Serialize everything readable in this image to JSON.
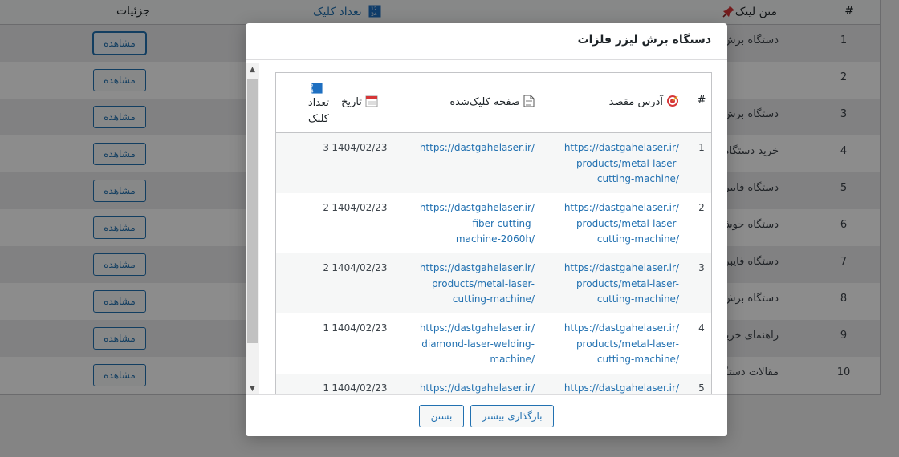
{
  "background": {
    "headers": {
      "index": "#",
      "link_text": "متن لینک",
      "click_count": "تعداد کلیک",
      "details": "جزئیات"
    },
    "view_label": "مشاهده",
    "rows": [
      {
        "n": "1",
        "text": "دستگاه برش لیز"
      },
      {
        "n": "2",
        "text": ""
      },
      {
        "n": "3",
        "text": "دستگاه برش لیز"
      },
      {
        "n": "4",
        "text": "خرید دستگاه بر"
      },
      {
        "n": "5",
        "text": "دستگاه فایبربرش"
      },
      {
        "n": "6",
        "text": "دستگاه جوش لیز"
      },
      {
        "n": "7",
        "text": "دستگاه فایبر مار"
      },
      {
        "n": "8",
        "text": "دستگاه برش فای"
      },
      {
        "n": "9",
        "text": "راهنمای خرید دس"
      },
      {
        "n": "10",
        "text": "مقالات دستگاه ب"
      }
    ]
  },
  "modal": {
    "title": "دستگاه برش لیزر فلزات",
    "columns": {
      "index": "#",
      "target": "آدرس مقصد",
      "page": "صفحه کلیک‌شده",
      "date": "تاریخ",
      "clicks": "تعداد کلیک"
    },
    "rows": [
      {
        "n": "1",
        "target": [
          "https://dastgahelaser.ir/",
          "products/metal-laser-",
          "cutting-machine/"
        ],
        "page": [
          "https://dastgahelaser.ir/"
        ],
        "date": "1404/02/23",
        "clicks": "3"
      },
      {
        "n": "2",
        "target": [
          "https://dastgahelaser.ir/",
          "products/metal-laser-",
          "cutting-machine/"
        ],
        "page": [
          "https://dastgahelaser.ir/",
          "fiber-cutting-",
          "machine-2060h/"
        ],
        "date": "1404/02/23",
        "clicks": "2"
      },
      {
        "n": "3",
        "target": [
          "https://dastgahelaser.ir/",
          "products/metal-laser-",
          "cutting-machine/"
        ],
        "page": [
          "https://dastgahelaser.ir/",
          "products/metal-laser-",
          "cutting-machine/"
        ],
        "date": "1404/02/23",
        "clicks": "2"
      },
      {
        "n": "4",
        "target": [
          "https://dastgahelaser.ir/",
          "products/metal-laser-",
          "cutting-machine/"
        ],
        "page": [
          "https://dastgahelaser.ir/",
          "diamond-laser-welding-",
          "machine/"
        ],
        "date": "1404/02/23",
        "clicks": "1"
      },
      {
        "n": "5",
        "target": [
          "https://dastgahelaser.ir/"
        ],
        "page": [
          "https://dastgahelaser.ir/"
        ],
        "date": "1404/02/23",
        "clicks": "1"
      }
    ],
    "buttons": {
      "load_more": "بارگذاری بیشتر",
      "close": "بستن"
    }
  },
  "icons": {
    "pin": "pushpin-icon",
    "counter": "numbers-icon",
    "target": "target-icon",
    "page": "page-icon",
    "calendar": "calendar-icon"
  },
  "colors": {
    "link": "#2271b1",
    "overlay": "rgba(0,0,0,0.45)",
    "pin": "#d63638"
  }
}
